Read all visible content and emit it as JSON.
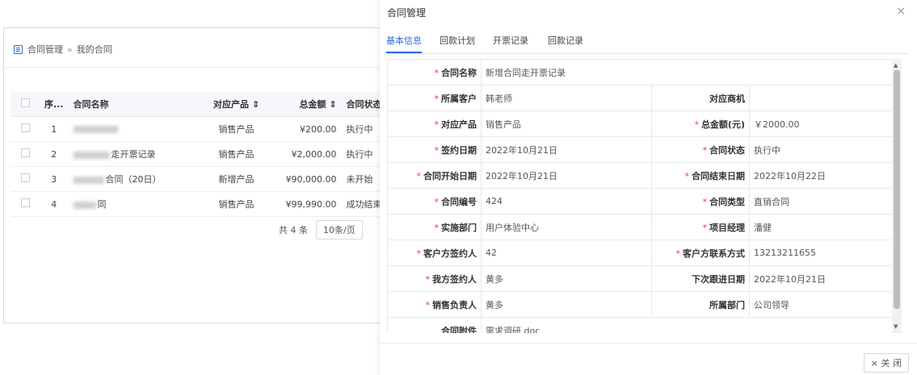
{
  "list": {
    "breadcrumb": {
      "root": "合同管理",
      "separator": "»",
      "current": "我的合同"
    },
    "columns": [
      "序...",
      "合同名称",
      "对应产品 ⇕",
      "总金额 ⇕",
      "合同状态"
    ],
    "rows": [
      {
        "index": "1",
        "name": "",
        "product": "销售产品",
        "amount": "¥200.00",
        "status": "执行中"
      },
      {
        "index": "2",
        "name": "走开票记录",
        "product": "销售产品",
        "amount": "¥2,000.00",
        "status": "执行中"
      },
      {
        "index": "3",
        "name": "合同（20日）",
        "product": "新增产品",
        "amount": "¥90,000.00",
        "status": "未开始"
      },
      {
        "index": "4",
        "name": "同",
        "product": "销售产品",
        "amount": "¥99,990.00",
        "status": "成功结束"
      }
    ],
    "pager": {
      "total": "共 4 条",
      "page_size": "10条/页"
    }
  },
  "modal": {
    "title": "合同管理",
    "close_icon": "×",
    "tabs": [
      "基本信息",
      "回款计划",
      "开票记录",
      "回款记录"
    ],
    "fields": {
      "contract_name": {
        "label": "合同名称",
        "value": "新增合同走开票记录"
      },
      "customer": {
        "label": "所属客户",
        "value": "韩老师"
      },
      "opportunity": {
        "label": "对应商机",
        "value": ""
      },
      "product": {
        "label": "对应产品",
        "value": "销售产品"
      },
      "total_amount": {
        "label": "总金额(元)",
        "value": "￥2000.00"
      },
      "sign_date": {
        "label": "签约日期",
        "value": "2022年10月21日"
      },
      "status": {
        "label": "合同状态",
        "value": "执行中"
      },
      "start_date": {
        "label": "合同开始日期",
        "value": "2022年10月21日"
      },
      "end_date": {
        "label": "合同结束日期",
        "value": "2022年10月22日"
      },
      "number": {
        "label": "合同编号",
        "value": "424"
      },
      "type": {
        "label": "合同类型",
        "value": "直销合同"
      },
      "department": {
        "label": "实施部门",
        "value": "用户体验中心"
      },
      "manager": {
        "label": "项目经理",
        "value": "潘健"
      },
      "customer_signer": {
        "label": "客户方签约人",
        "value": "42"
      },
      "customer_contact": {
        "label": "客户方联系方式",
        "value": "13213211655"
      },
      "our_signer": {
        "label": "我方签约人",
        "value": "黄多"
      },
      "next_follow": {
        "label": "下次跟进日期",
        "value": "2022年10月21日"
      },
      "sales_owner": {
        "label": "销售负责人",
        "value": "黄多"
      },
      "owner_dept": {
        "label": "所属部门",
        "value": "公司领导"
      },
      "attachment": {
        "label": "合同附件",
        "value": "需求调研.doc"
      }
    },
    "close_button": "× 关 闭"
  }
}
